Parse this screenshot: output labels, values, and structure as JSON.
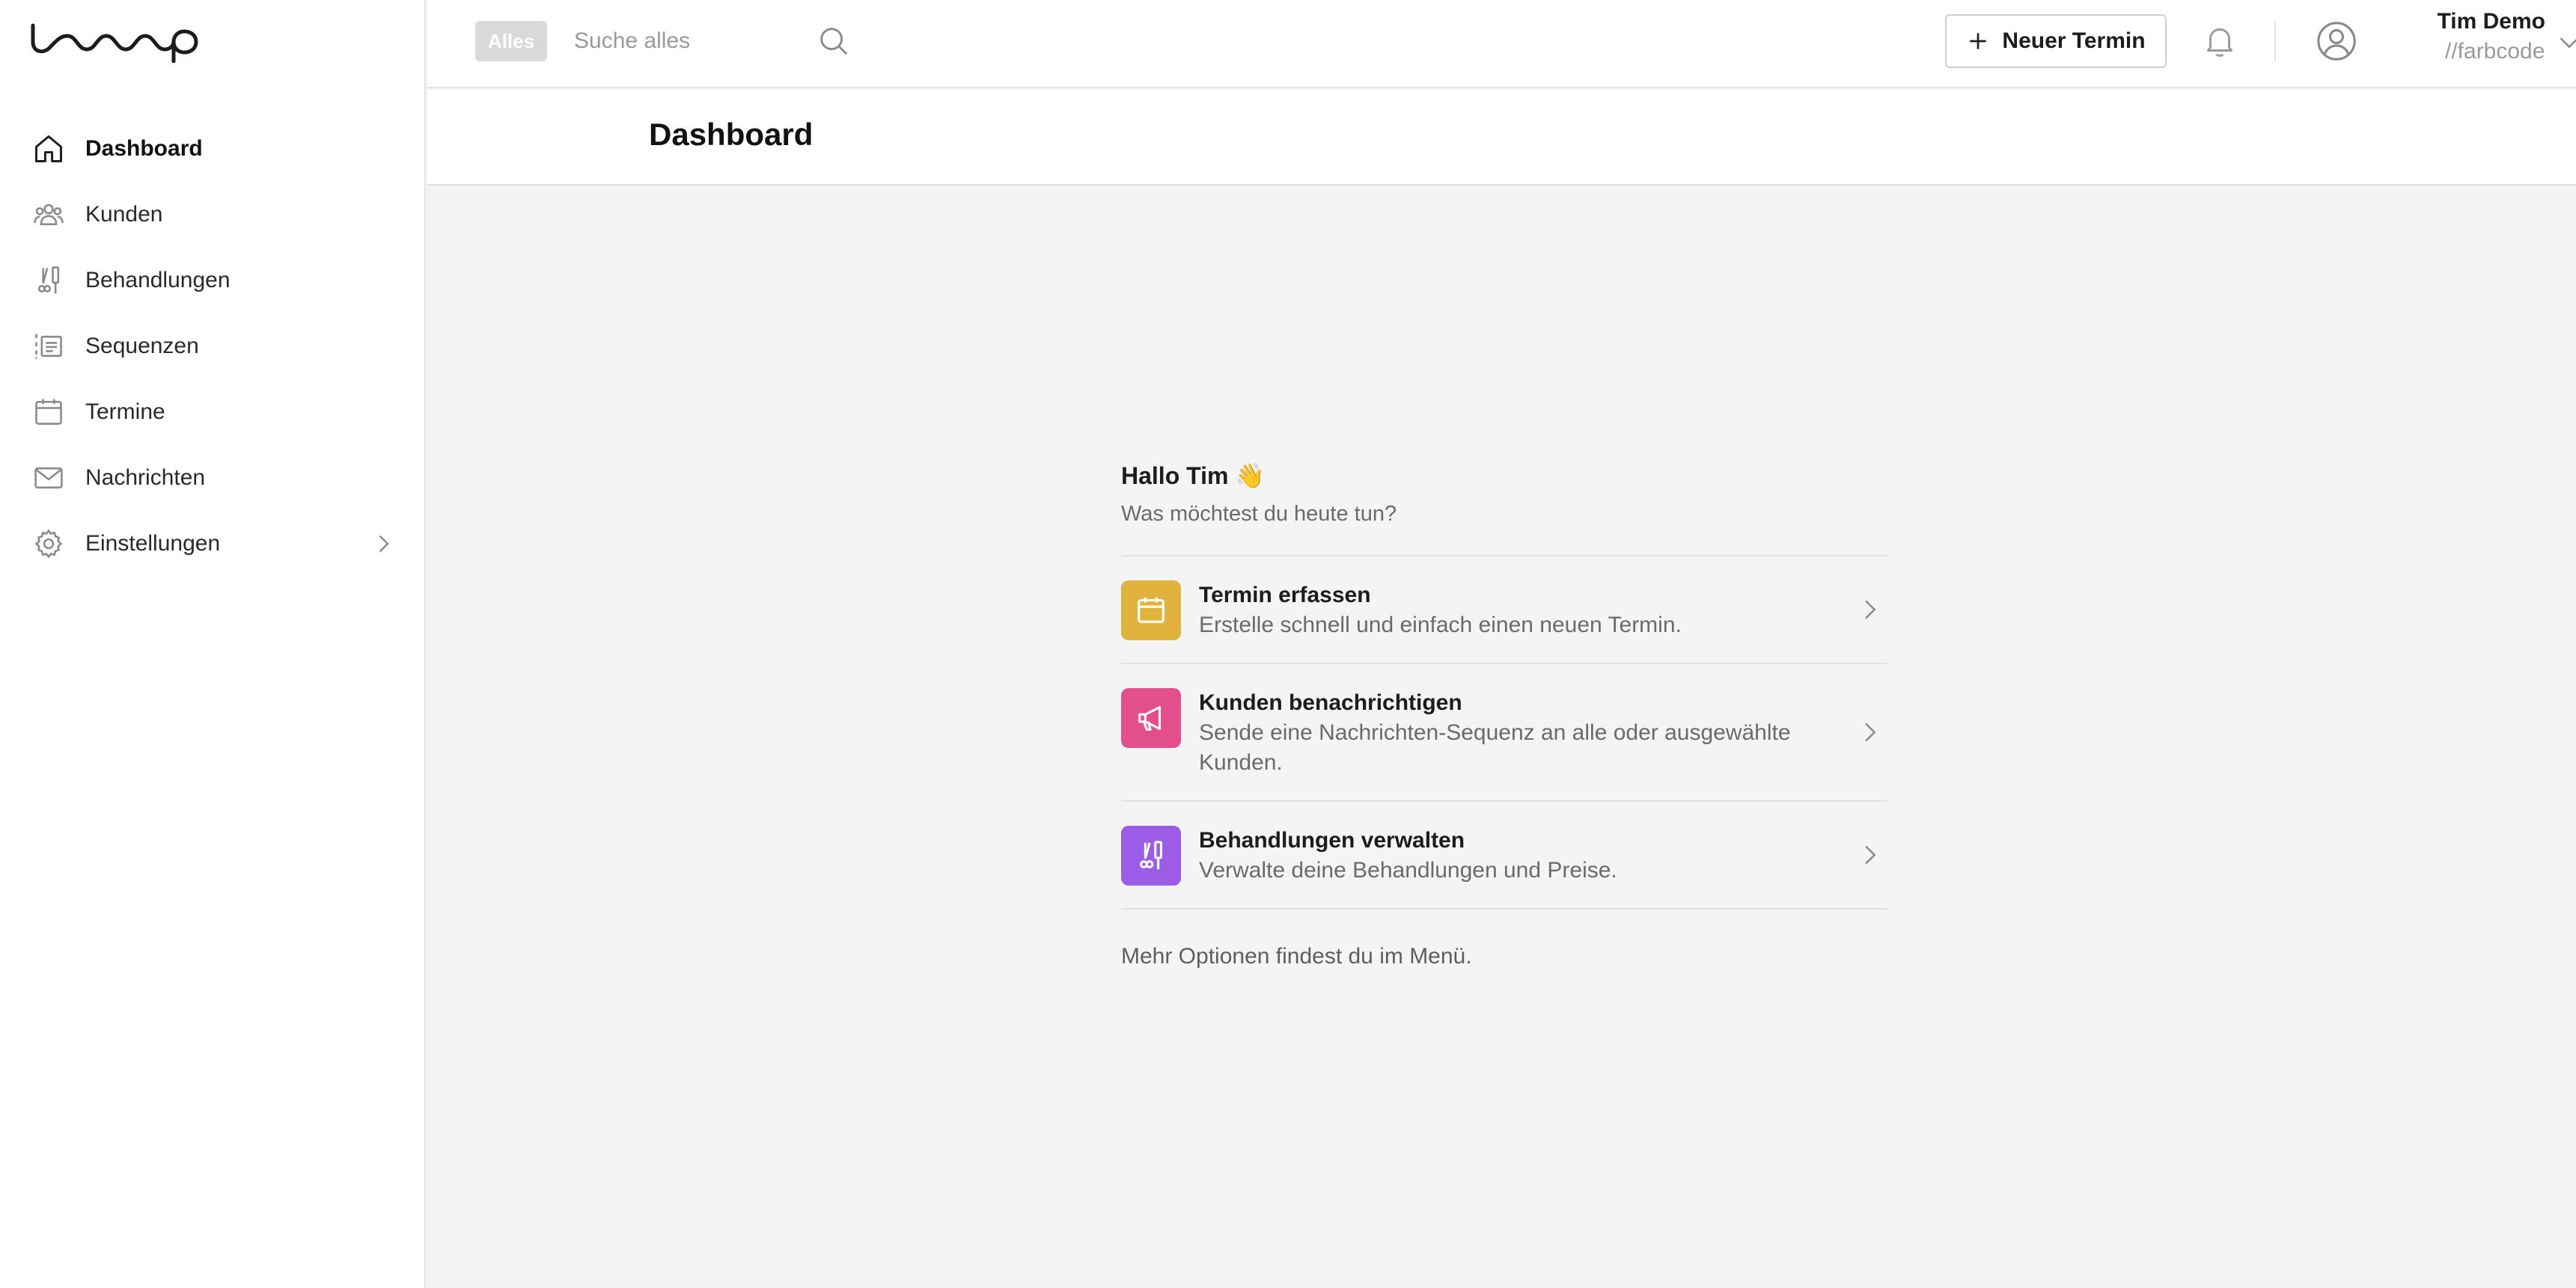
{
  "app": {
    "logo_alt": "looop"
  },
  "colors": {
    "accent_yellow": "#e2b33c",
    "accent_pink": "#e24f8c",
    "accent_purple": "#9b5de5"
  },
  "sidebar": {
    "items": [
      {
        "label": "Dashboard",
        "icon": "home-icon",
        "active": true
      },
      {
        "label": "Kunden",
        "icon": "users-icon"
      },
      {
        "label": "Behandlungen",
        "icon": "treatment-icon"
      },
      {
        "label": "Sequenzen",
        "icon": "sequence-icon"
      },
      {
        "label": "Termine",
        "icon": "calendar-icon"
      },
      {
        "label": "Nachrichten",
        "icon": "mail-icon"
      },
      {
        "label": "Einstellungen",
        "icon": "gear-icon",
        "has_submenu": true
      }
    ]
  },
  "topbar": {
    "filter_label": "Alles",
    "search_placeholder": "Suche alles",
    "new_appointment_label": "Neuer Termin",
    "user_name": "Tim Demo",
    "user_org": "//farbcode"
  },
  "page": {
    "title": "Dashboard"
  },
  "main": {
    "greeting": "Hallo Tim 👋",
    "subgreeting": "Was möchtest du heute tun?",
    "actions": [
      {
        "title": "Termin erfassen",
        "description": "Erstelle schnell und einfach einen neuen Termin.",
        "icon": "calendar-icon",
        "color": "#e2b33c"
      },
      {
        "title": "Kunden benachrichtigen",
        "description": "Sende eine Nachrichten-Sequenz an alle oder ausgewählte Kunden.",
        "icon": "megaphone-icon",
        "color": "#e24f8c"
      },
      {
        "title": "Behandlungen verwalten",
        "description": "Verwalte deine Behandlungen und Preise.",
        "icon": "treatment-icon",
        "color": "#9b5de5"
      }
    ],
    "more_options": "Mehr Optionen findest du im Menü."
  }
}
